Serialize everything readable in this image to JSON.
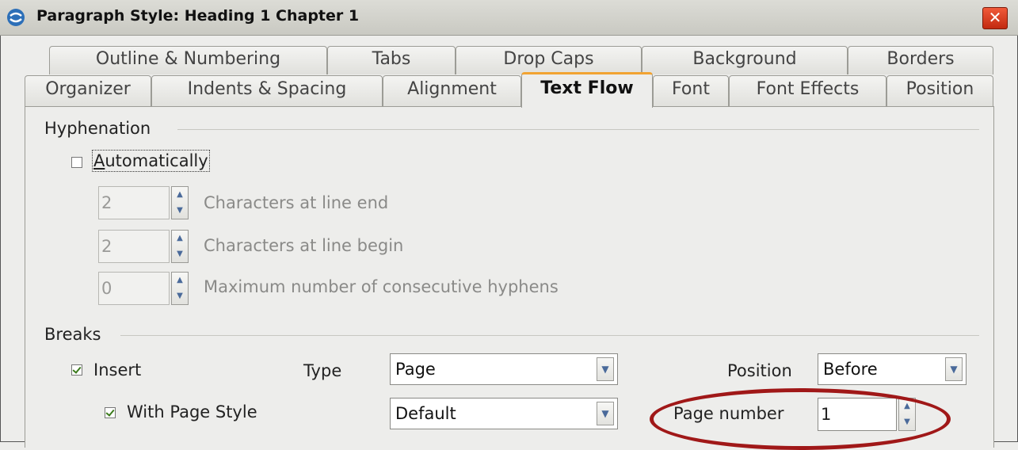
{
  "window": {
    "title": "Paragraph Style: Heading 1 Chapter 1",
    "close_glyph": "✕"
  },
  "tabs": {
    "row1": [
      "Outline & Numbering",
      "Tabs",
      "Drop Caps",
      "Background",
      "Borders"
    ],
    "row2": [
      "Organizer",
      "Indents & Spacing",
      "Alignment",
      "Text Flow",
      "Font",
      "Font Effects",
      "Position"
    ],
    "active": "Text Flow"
  },
  "hyphenation": {
    "section_label": "Hyphenation",
    "automatically_label": "Automatically",
    "automatically_checked": false,
    "chars_line_end_value": "2",
    "chars_line_end_label": "Characters at line end",
    "chars_line_begin_value": "2",
    "chars_line_begin_label": "Characters at line begin",
    "max_hyphens_value": "0",
    "max_hyphens_label": "Maximum number of consecutive hyphens"
  },
  "breaks": {
    "section_label": "Breaks",
    "insert_label": "Insert",
    "insert_checked": true,
    "type_label": "Type",
    "type_value": "Page",
    "position_label": "Position",
    "position_value": "Before",
    "with_page_style_label": "With Page Style",
    "with_page_style_checked": true,
    "page_style_value": "Default",
    "page_number_label": "Page number",
    "page_number_value": "1"
  },
  "colors": {
    "active_tab_accent": "#f2a332",
    "highlight_ellipse": "#a01818",
    "close_button": "#d8381c"
  },
  "icons": {
    "app": "libreoffice-icon",
    "close": "close-icon",
    "spin": "spin-arrows-icon",
    "dropdown": "chevron-down-icon"
  }
}
